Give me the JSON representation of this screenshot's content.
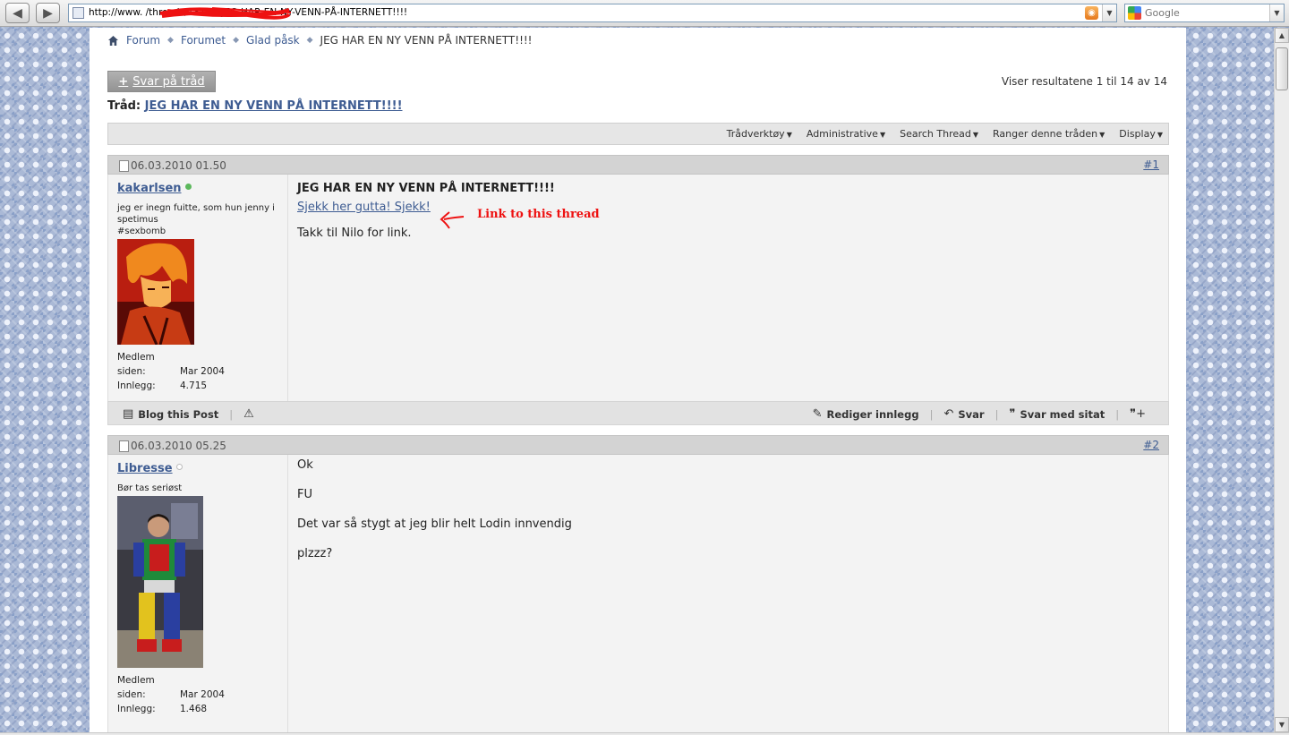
{
  "browser": {
    "url": "http://www.                   /threads/18118-JEG-HAR-EN-NY-VENN-PÅ-INTERNETT!!!!",
    "search_placeholder": "Google"
  },
  "breadcrumb": {
    "items": [
      "Forum",
      "Forumet",
      "Glad påsk"
    ],
    "current": "JEG HAR EN NY VENN PÅ INTERNETT!!!!"
  },
  "reply_button": "Svar på tråd",
  "results": "Viser resultatene 1 til 14 av 14",
  "thread": {
    "label": "Tråd:",
    "title": "JEG HAR EN NY VENN PÅ INTERNETT!!!!"
  },
  "thread_tools": [
    "Trådverktøy",
    "Administrative",
    "Search Thread",
    "Ranger denne tråden",
    "Display"
  ],
  "colors": {
    "link": "#3e5c92",
    "online": "#5cb85c",
    "offline": "#bbbbbb",
    "annotation": "#ee1111"
  },
  "posts": [
    {
      "date": "06.03.2010 01.50",
      "number": "#1",
      "username": "kakarlsen",
      "online": true,
      "usertitle": "jeg er inegn fuitte, som hun jenny i spetimus\n#sexbomb",
      "member_since_label": "Medlem siden:",
      "member_since": "Mar 2004",
      "posts_label": "Innlegg:",
      "post_count": "4.715",
      "title": "JEG HAR EN NY VENN PÅ INTERNETT!!!!",
      "link_text": "Sjekk her gutta! Sjekk!",
      "annotation": "Link to this thread",
      "body": [
        "Takk til Nilo for link."
      ],
      "footer": {
        "blog": "Blog this Post",
        "edit": "Rediger innlegg",
        "reply": "Svar",
        "quote": "Svar med sitat"
      }
    },
    {
      "date": "06.03.2010 05.25",
      "number": "#2",
      "username": "Libresse",
      "online": false,
      "usertitle": "Bør tas seriøst",
      "member_since_label": "Medlem siden:",
      "member_since": "Mar 2004",
      "posts_label": "Innlegg:",
      "post_count": "1.468",
      "body": [
        "Ok",
        "FU",
        "Det var så stygt at jeg blir helt Lodin innvendig",
        "plzzz?"
      ]
    }
  ]
}
